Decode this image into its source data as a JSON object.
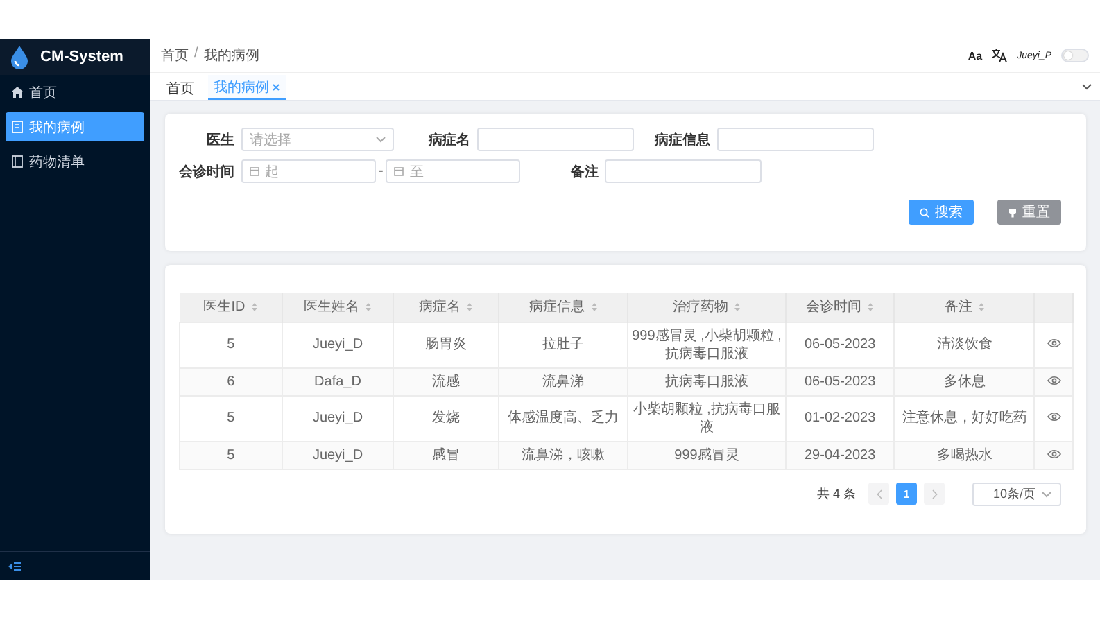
{
  "sidebar": {
    "title": "CM-System",
    "items": [
      {
        "label": "首页",
        "selected": false
      },
      {
        "label": "我的病例",
        "selected": true
      },
      {
        "label": "药物清单",
        "selected": false
      }
    ]
  },
  "header": {
    "breadcrumb": [
      "首页",
      "我的病例"
    ],
    "breadcrumb_separator": "/",
    "font_button": "Aa",
    "user": "Jueyi_P",
    "dark_mode": false
  },
  "tabs": [
    {
      "label": "首页",
      "selected": false,
      "closable": false
    },
    {
      "label": "我的病例",
      "selected": true,
      "closable": true
    }
  ],
  "filters": {
    "doctor": {
      "label": "医生",
      "placeholder": "请选择"
    },
    "disease": {
      "label": "病症名"
    },
    "info": {
      "label": "病症信息"
    },
    "date": {
      "label": "会诊时间",
      "start_placeholder": "起",
      "separator": "-",
      "end_placeholder": "至"
    },
    "note": {
      "label": "备注"
    },
    "search_button": "搜索",
    "reset_button": "重置"
  },
  "table": {
    "columns": [
      "医生ID",
      "医生姓名",
      "病症名",
      "病症信息",
      "治疗药物",
      "会诊时间",
      "备注"
    ],
    "rows": [
      [
        "5",
        "Jueyi_D",
        "肠胃炎",
        "拉肚子",
        "999感冒灵 ,小柴胡颗粒 ,抗病毒口服液",
        "06-05-2023",
        "清淡饮食"
      ],
      [
        "6",
        "Dafa_D",
        "流感",
        "流鼻涕",
        "抗病毒口服液",
        "06-05-2023",
        "多休息"
      ],
      [
        "5",
        "Jueyi_D",
        "发烧",
        "体感温度高、乏力",
        "小柴胡颗粒 ,抗病毒口服液",
        "01-02-2023",
        "注意休息，好好吃药"
      ],
      [
        "5",
        "Jueyi_D",
        "感冒",
        "流鼻涕，咳嗽",
        "999感冒灵",
        "29-04-2023",
        "多喝热水"
      ]
    ]
  },
  "pagination": {
    "total": "共 4 条",
    "pages": [
      {
        "label": "1",
        "selected": true
      }
    ],
    "page_size": "10条/页"
  }
}
